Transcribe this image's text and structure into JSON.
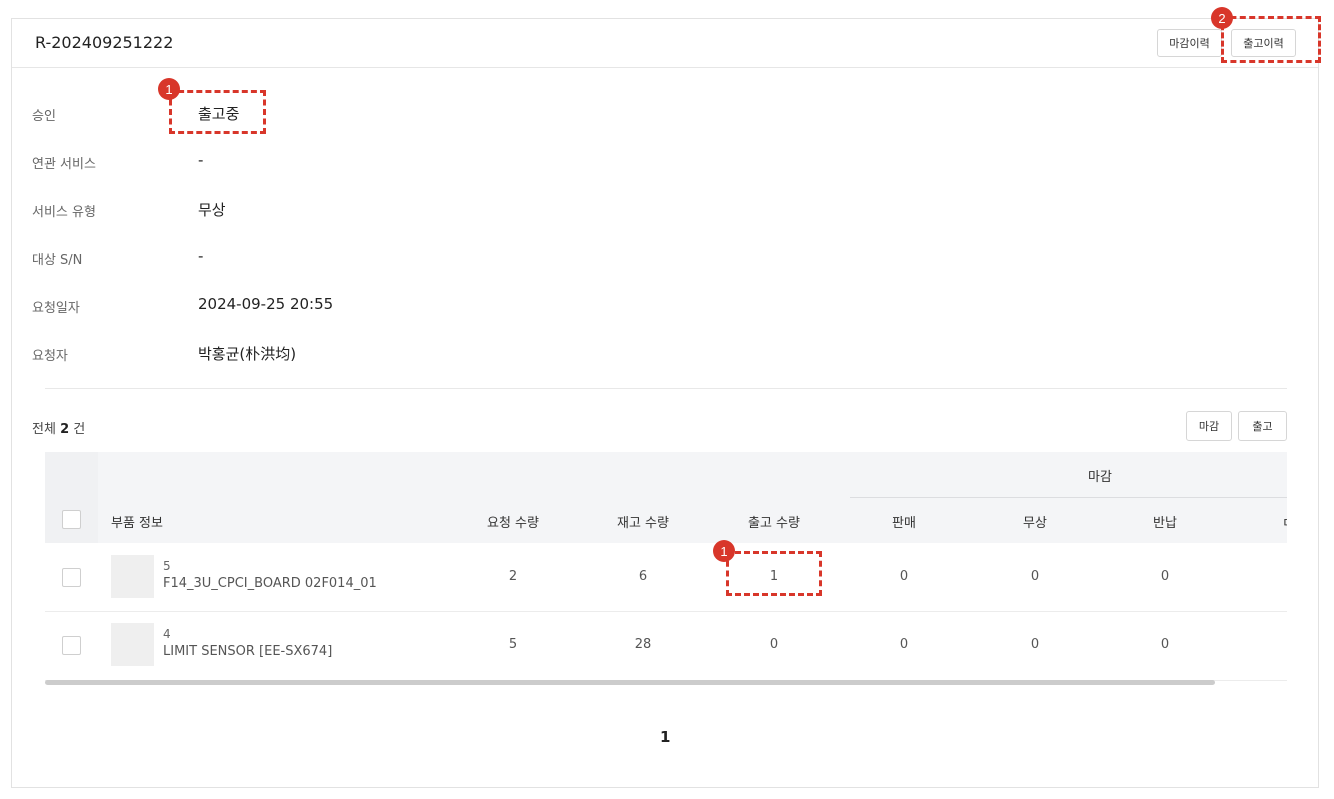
{
  "header": {
    "title": "R-202409251222",
    "close_history_button": "마감이력",
    "release_history_button": "출고이력"
  },
  "info": [
    {
      "label": "승인",
      "value": "출고중"
    },
    {
      "label": "연관 서비스",
      "value": "-"
    },
    {
      "label": "서비스 유형",
      "value": "무상"
    },
    {
      "label": "대상 S/N",
      "value": "-"
    },
    {
      "label": "요청일자",
      "value": "2024-09-25 20:55"
    },
    {
      "label": "요청자",
      "value": "박홍균(朴洪均)"
    }
  ],
  "list": {
    "total_prefix": "전체",
    "total_count": "2",
    "total_suffix": "건",
    "close_button": "마감",
    "release_button": "출고"
  },
  "table": {
    "headers": {
      "part_info": "부품 정보",
      "request_qty": "요청 수량",
      "stock_qty": "재고 수량",
      "release_qty": "출고 수량",
      "group": "마감",
      "sale": "판매",
      "free": "무상",
      "return": "반납"
    },
    "rows": [
      {
        "num": "5",
        "name": "F14_3U_CPCI_BOARD 02F014_01",
        "request_qty": "2",
        "stock_qty": "6",
        "release_qty": "1",
        "sale": "0",
        "free": "0",
        "return": "0"
      },
      {
        "num": "4",
        "name": "LIMIT SENSOR [EE-SX674]",
        "request_qty": "5",
        "stock_qty": "28",
        "release_qty": "0",
        "sale": "0",
        "free": "0",
        "return": "0"
      }
    ]
  },
  "pagination": {
    "current_page": "1"
  },
  "annotations": {
    "marker_1": "1",
    "marker_2": "2",
    "color": "#d8362a"
  }
}
